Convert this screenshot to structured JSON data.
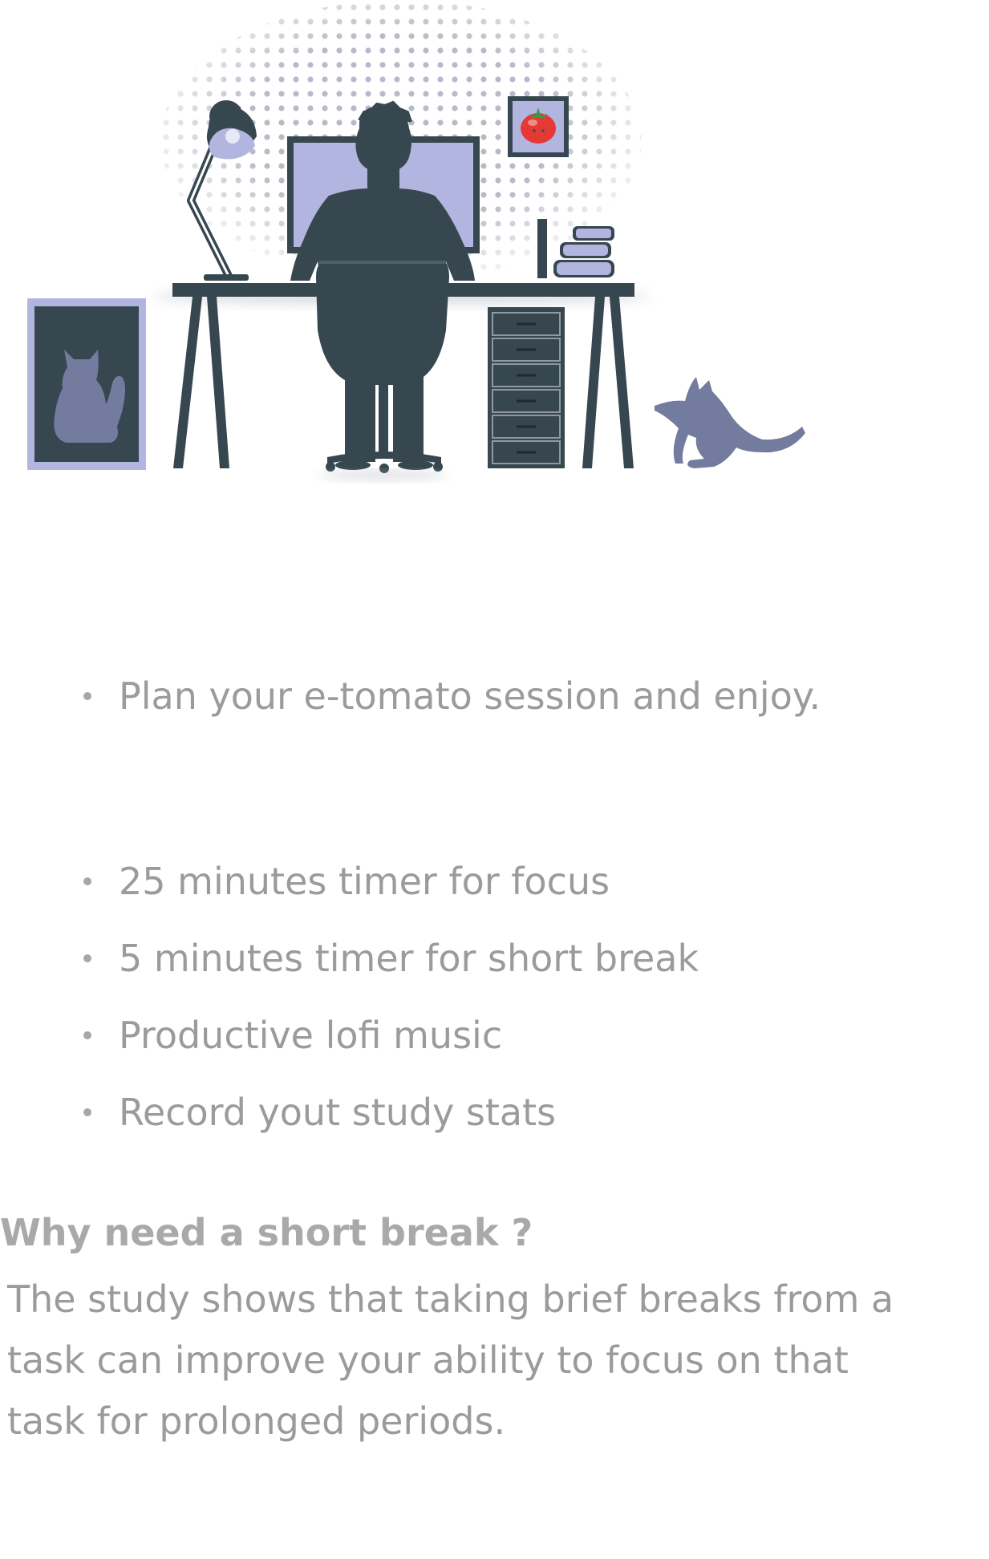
{
  "illustration": {
    "name": "person at desk with cat",
    "colors": {
      "dark": "#37474f",
      "lavender": "#b2b5df",
      "cat_purple": "#737b9e",
      "dots": "#b9b9c9",
      "tomato_red": "#e53935",
      "tomato_leaf": "#2e9e44"
    }
  },
  "intro": {
    "items": [
      {
        "text": "Plan your e-tomato session and enjoy."
      }
    ]
  },
  "features": {
    "items": [
      {
        "text": "25 minutes timer for focus"
      },
      {
        "text": "5 minutes timer for short break"
      },
      {
        "text": "Productive lofi music"
      },
      {
        "text": "Record yout study stats"
      }
    ]
  },
  "why": {
    "title": "Why need a short break ?",
    "body": "The study shows that taking brief breaks from a task can improve your ability to focus on that task for prolonged periods."
  }
}
